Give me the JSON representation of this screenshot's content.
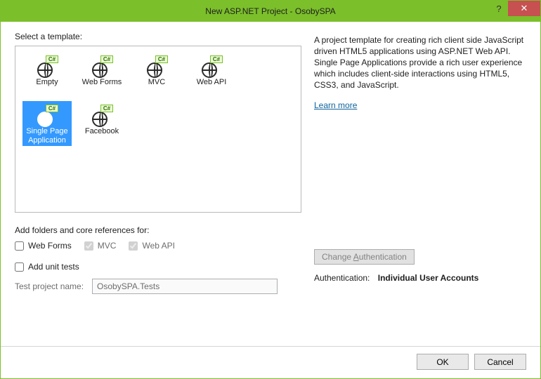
{
  "titlebar": {
    "title": "New ASP.NET Project - OsobySPA"
  },
  "select_label": "Select a template:",
  "templates": {
    "r1": [
      {
        "label": "Empty"
      },
      {
        "label": "Web Forms"
      },
      {
        "label": "MVC"
      },
      {
        "label": "Web API"
      }
    ],
    "r2": [
      {
        "label": "Single Page Application",
        "selected": true
      },
      {
        "label": "Facebook"
      }
    ]
  },
  "description": "A project template for creating rich client side JavaScript driven HTML5 applications using ASP.NET Web API. Single Page Applications provide a rich user experience which includes client-side interactions using HTML5, CSS3, and JavaScript.",
  "learn_more": "Learn more",
  "refs_label": "Add folders and core references for:",
  "refs": {
    "webforms": {
      "label": "Web Forms",
      "checked": false,
      "enabled": true
    },
    "mvc": {
      "label": "MVC",
      "checked": true,
      "enabled": false
    },
    "webapi": {
      "label": "Web API",
      "checked": true,
      "enabled": false
    }
  },
  "unit_tests": {
    "label": "Add unit tests",
    "checked": false
  },
  "test_project": {
    "label": "Test project name:",
    "value": "OsobySPA.Tests"
  },
  "auth_button": "Change Authentication",
  "auth_label": "Authentication:",
  "auth_value": "Individual User Accounts",
  "buttons": {
    "ok": "OK",
    "cancel": "Cancel"
  },
  "icon_tag": "C#"
}
